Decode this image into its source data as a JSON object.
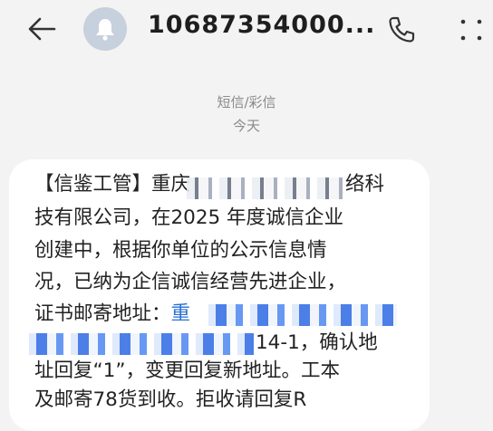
{
  "header": {
    "back_icon": "back-arrow-icon",
    "avatar_icon": "bell-icon",
    "sender": "10687354000...",
    "call_icon": "phone-icon",
    "more_icon": "more-dots-icon"
  },
  "meta": {
    "channel": "短信/彩信",
    "date": "今天"
  },
  "message": {
    "lines": [
      {
        "before": "【信鉴工管】重庆",
        "after": "络科"
      },
      {
        "text": "技有限公司，在2025 年度诚信企业"
      },
      {
        "text": "创建中，根据你单位的公示信息情"
      },
      {
        "text": "况，已纳为企信诚信经营先进企业，"
      },
      {
        "before": "证书邮寄地址：",
        "link": "重"
      },
      {
        "after": "14-1，确认地"
      },
      {
        "text": "址回复“1”，变更回复新地址。工本"
      },
      {
        "text": "及邮寄78货到收。拒收请回复R"
      }
    ]
  },
  "colors": {
    "background": "#f3f3f3",
    "bubble": "#ffffff",
    "link": "#2a6fd6",
    "meta_text": "#8a8a8a"
  }
}
